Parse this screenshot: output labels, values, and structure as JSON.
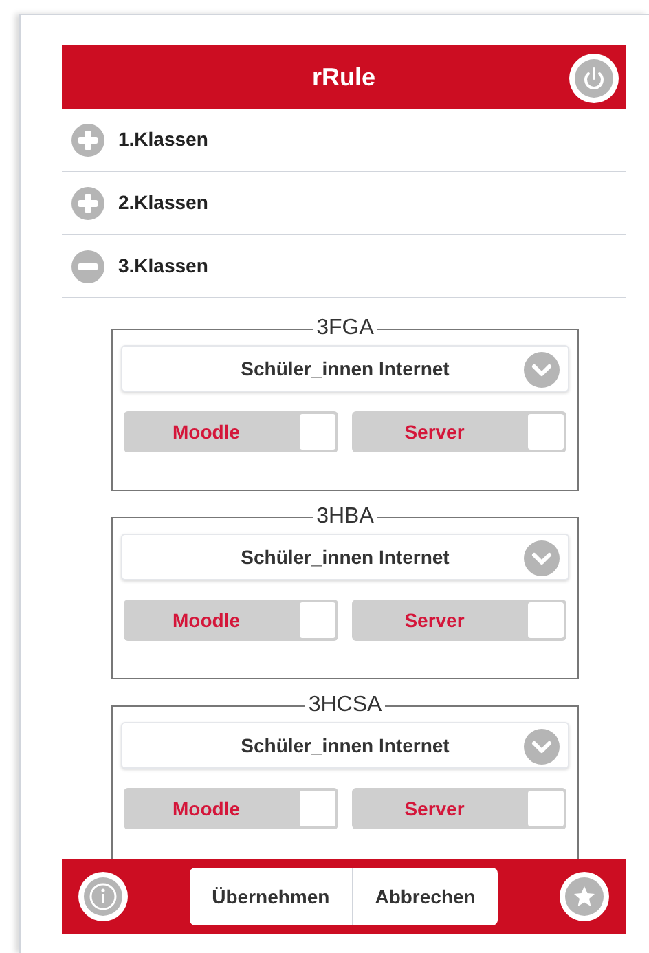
{
  "header": {
    "title": "rRule"
  },
  "groups": [
    {
      "label": "1.Klassen",
      "expanded": false
    },
    {
      "label": "2.Klassen",
      "expanded": false
    },
    {
      "label": "3.Klassen",
      "expanded": true,
      "classes": [
        {
          "name": "3FGA",
          "profile": "Schüler_innen Internet",
          "toggles": [
            {
              "label": "Moodle",
              "on": false
            },
            {
              "label": "Server",
              "on": false
            }
          ]
        },
        {
          "name": "3HBA",
          "profile": "Schüler_innen Internet",
          "toggles": [
            {
              "label": "Moodle",
              "on": false
            },
            {
              "label": "Server",
              "on": false
            }
          ]
        },
        {
          "name": "3HCSA",
          "profile": "Schüler_innen Internet",
          "toggles": [
            {
              "label": "Moodle",
              "on": false
            },
            {
              "label": "Server",
              "on": false
            }
          ]
        }
      ]
    }
  ],
  "footer": {
    "buttons": [
      "Übernehmen",
      "Abbrechen"
    ]
  }
}
